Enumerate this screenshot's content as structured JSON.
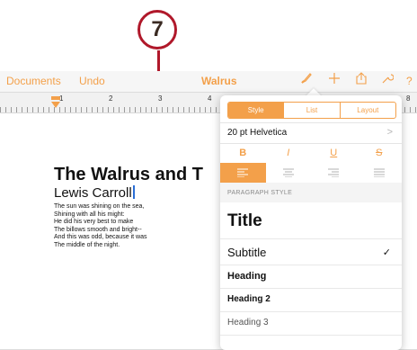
{
  "callout": {
    "number": "7"
  },
  "toolbar": {
    "documents": "Documents",
    "undo": "Undo",
    "title": "Walrus",
    "icons": [
      "paintbrush-icon",
      "plus-icon",
      "share-icon",
      "wrench-icon",
      "help-icon"
    ],
    "help": "?"
  },
  "ruler": {
    "numbers": [
      "1",
      "2",
      "3",
      "4",
      "8"
    ]
  },
  "document": {
    "title": "The Walrus and T",
    "subtitle": "Lewis Carroll",
    "body": [
      "The sun was shining on the sea,",
      "Shining with all his might:",
      "He did his very best to make",
      "The billows smooth and bright--",
      "And this was odd, because it was",
      "The middle of the night."
    ]
  },
  "format_popover": {
    "tabs": [
      "Style",
      "List",
      "Layout"
    ],
    "active_tab": "Style",
    "font": "20 pt Helvetica",
    "chevron": ">",
    "style_buttons": [
      "B",
      "I",
      "U",
      "S"
    ],
    "align_buttons": [
      "align-left-icon",
      "align-center-icon",
      "align-right-icon",
      "align-justify-icon"
    ],
    "active_align": "align-left-icon",
    "section_header": "PARAGRAPH STYLE",
    "styles": [
      "Title",
      "Subtitle",
      "Heading",
      "Heading 2",
      "Heading 3"
    ],
    "checked_style": "Subtitle",
    "checkmark": "✓"
  },
  "colors": {
    "accent": "#f3a04a",
    "callout": "#b0182a",
    "cursor": "#2b6fd6"
  }
}
